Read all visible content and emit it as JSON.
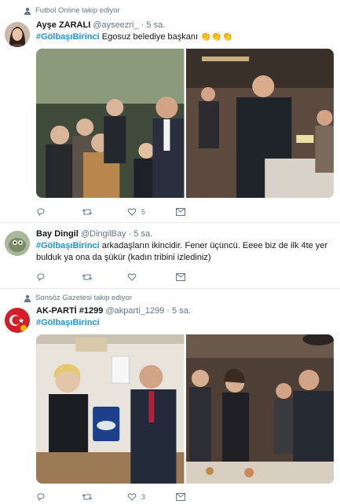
{
  "tweets": [
    {
      "context": "Futbol Online takip ediyor",
      "name": "Ayşe ZARALI",
      "handle": "@ayseezri_",
      "time": "5 sa.",
      "hashtag": "#GölbaşıBirinci",
      "text": " Egosuz belediye başkanı ",
      "emoji": "👏👏👏",
      "likes": "5"
    },
    {
      "name": "Bay Dingil",
      "handle": "@DingilBay",
      "time": "5 sa.",
      "hashtag": "#GölbaşıBirinci",
      "text": " arkadaşların ikincidir.  Fener üçüncü.  Eeee biz de ilk 4te yer bulduk ya ona da şükür (kadın tribini izlediniz)"
    },
    {
      "context": "Sonsöz Gazetesi takip ediyor",
      "name": "AK-PARTİ #1299",
      "handle": "@akparti_1299",
      "time": "5 sa.",
      "hashtag": "#GölbaşıBirinci",
      "likes": "3"
    }
  ],
  "icons": {
    "reply": "reply-icon",
    "retweet": "retweet-icon",
    "like": "heart-icon",
    "dm": "envelope-icon",
    "context": "person-icon"
  },
  "colors": {
    "accent": "#1b95e0",
    "muted": "#657786",
    "border": "#e6ecf0"
  }
}
